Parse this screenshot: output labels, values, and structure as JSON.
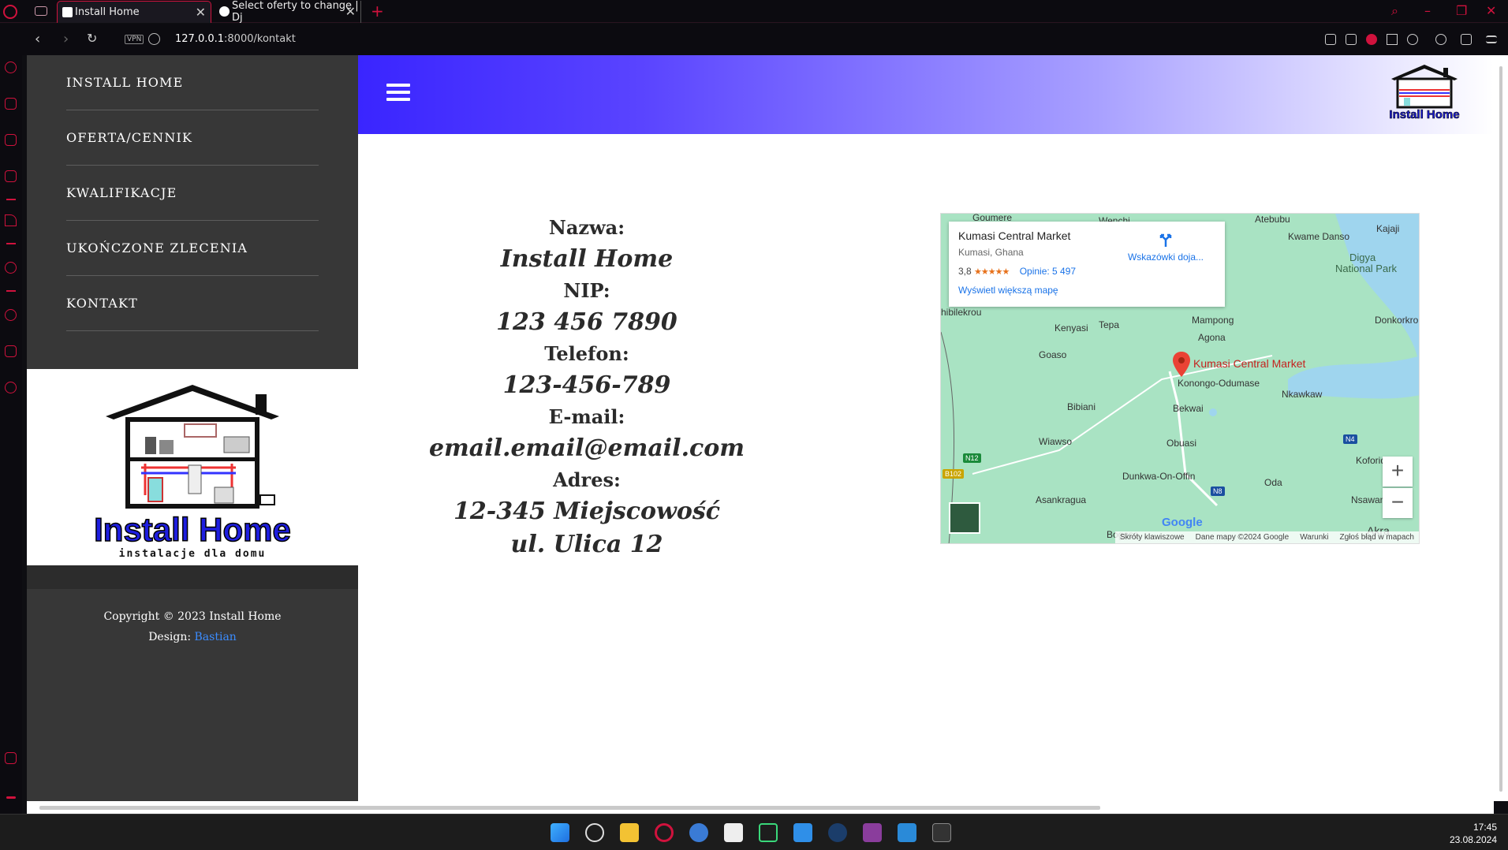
{
  "browser": {
    "tabs": [
      {
        "title": "Install Home",
        "active": true
      },
      {
        "title": "Select oferty to change | Dj",
        "active": false
      }
    ],
    "address": {
      "host": "127.0.0.1",
      "path": ":8000/kontakt"
    },
    "vpn_label": "VPN"
  },
  "site": {
    "menu": [
      "INSTALL HOME",
      "OFERTA/CENNIK",
      "KWALIFIKACJE",
      "UKOŃCZONE ZLECENIA",
      "KONTAKT"
    ],
    "logo_text": "Install Home",
    "logo_tagline": "instalacje dla domu",
    "footer": {
      "copyright": "Copyright © 2023 Install Home",
      "design_label": "Design: ",
      "design_link": "Bastian"
    },
    "header_logo_text": "Install Home"
  },
  "contact": {
    "name_label": "Nazwa:",
    "name_value": "Install Home",
    "nip_label": "NIP:",
    "nip_value": "123 456 7890",
    "phone_label": "Telefon:",
    "phone_value": "123-456-789",
    "email_label": "E-mail:",
    "email_value": "email.email@email.com",
    "address_label": "Adres:",
    "address_line1": "12-345 Miejscowość",
    "address_line2": "ul. Ulica 12"
  },
  "map": {
    "place_title": "Kumasi Central Market",
    "place_subtitle": "Kumasi, Ghana",
    "rating": "3,8",
    "stars": "★★★★★",
    "reviews": "Opinie: 5 497",
    "directions": "Wskazówki doja...",
    "bigger_map": "Wyświetl większą mapę",
    "marker_label": "Kumasi Central Market",
    "places": [
      "Atebubu",
      "Kwame Danso",
      "Kajaji",
      "Digya",
      "National Park",
      "Mampong",
      "Agona",
      "Donkorkro",
      "Kenyasi",
      "Tepa",
      "Goaso",
      "Konongo-Odumase",
      "Nkawkaw",
      "Bibiani",
      "Bekwai",
      "Wiawso",
      "Obuasi",
      "Koforidua",
      "Dunkwa-On-Offin",
      "Oda",
      "Asankragua",
      "Nsawam",
      "Bogoso",
      "Akra",
      "Wenchi",
      "Goumere",
      "hibilekrou"
    ],
    "roads": [
      "N12",
      "B102",
      "N4",
      "N8"
    ],
    "zoom_in": "+",
    "zoom_out": "−",
    "google": "Google",
    "attribution": [
      "Skróty klawiszowe",
      "Dane mapy ©2024 Google",
      "Warunki",
      "Zgłoś błąd w mapach"
    ]
  },
  "taskbar": {
    "time": "17:45",
    "date": "23.08.2024"
  },
  "colors": {
    "accent": "#d0123d",
    "header_start": "#3a25ff",
    "menu_bg": "#373737",
    "link": "#3b8cff"
  }
}
